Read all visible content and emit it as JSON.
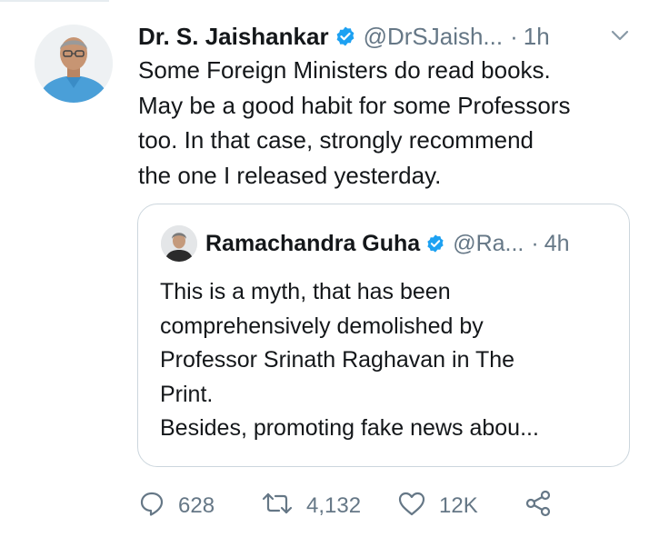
{
  "tweet": {
    "author_name": "Dr. S. Jaishankar",
    "handle": "@DrSJaish...",
    "separator": "·",
    "time": "1h",
    "text": "Some Foreign Ministers do read books.\nMay be a good habit for some Professors\ntoo. In that case, strongly recommend\nthe one I released yesterday."
  },
  "quoted_tweet": {
    "author_name": "Ramachandra Guha",
    "handle": "@Ra...",
    "separator": "·",
    "time": "4h",
    "text": "This is a myth, that has been\ncomprehensively demolished by\nProfessor Srinath Raghavan in The\nPrint.\nBesides, promoting fake news abou..."
  },
  "actions": {
    "replies": "628",
    "retweets": "4,132",
    "likes": "12K"
  },
  "icons": {
    "verified": "verified-badge-icon",
    "caret": "chevron-down-icon",
    "reply": "reply-icon",
    "retweet": "retweet-icon",
    "like": "heart-icon",
    "share": "share-icon"
  },
  "colors": {
    "verified_blue": "#1da1f2",
    "text": "#14171a",
    "secondary": "#657786",
    "border": "#ccd6dd"
  }
}
